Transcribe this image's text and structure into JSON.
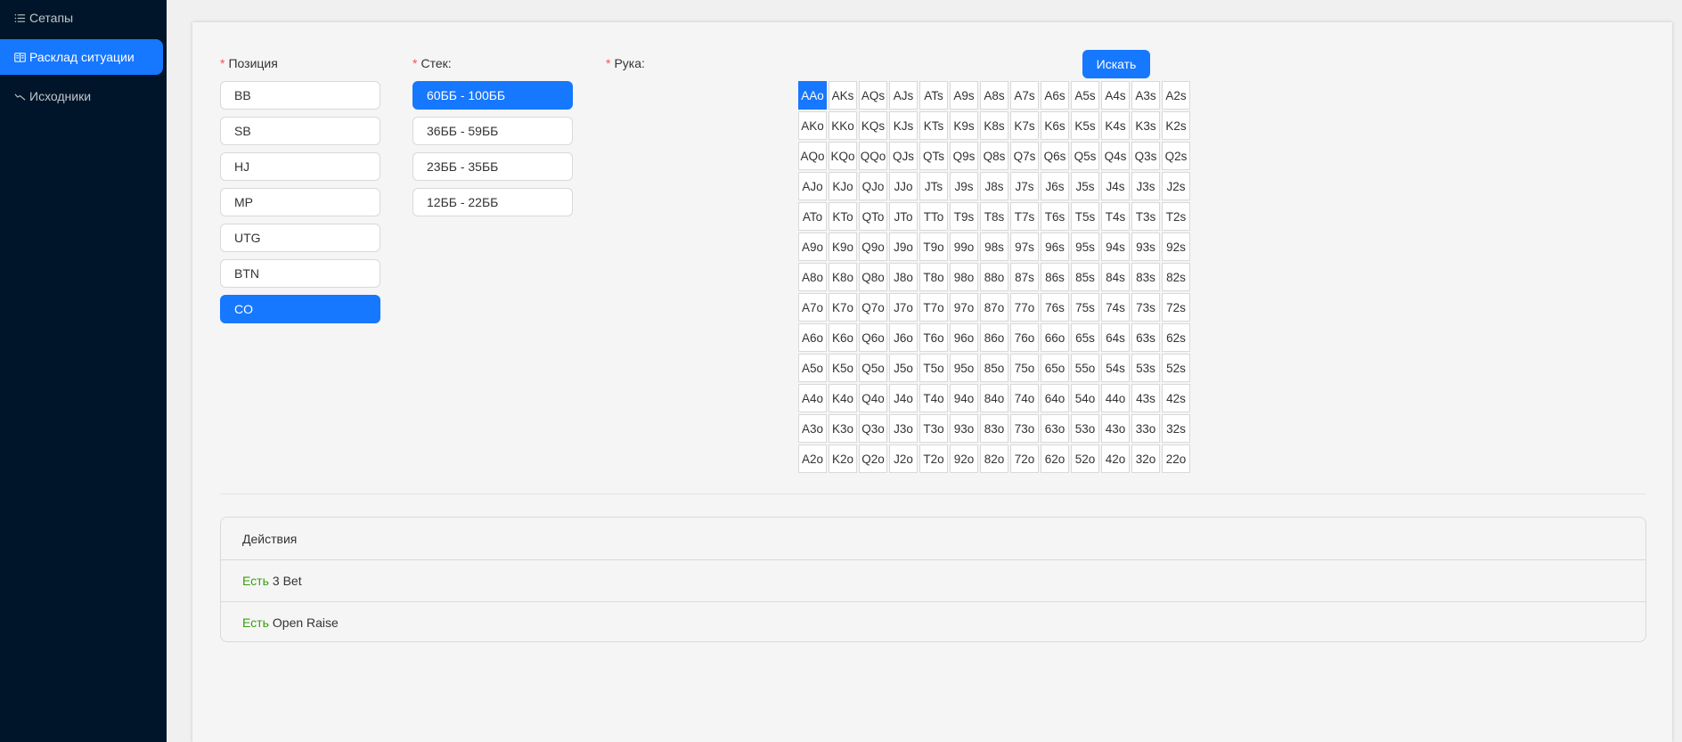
{
  "sidebar": {
    "items": [
      {
        "label": "Сетапы",
        "icon": "list-icon",
        "active": false
      },
      {
        "label": "Расклад ситуации",
        "icon": "read-icon",
        "active": true
      },
      {
        "label": "Исходники",
        "icon": "stock-icon",
        "active": false
      }
    ]
  },
  "form": {
    "position_label": "Позиция",
    "stack_label": "Стек:",
    "hand_label": "Рука:",
    "required_mark": "*",
    "positions": [
      "BB",
      "SB",
      "HJ",
      "MP",
      "UTG",
      "BTN",
      "CO"
    ],
    "selected_position": "CO",
    "stacks": [
      "60ББ - 100ББ",
      "36ББ - 59ББ",
      "23ББ - 35ББ",
      "12ББ - 22ББ"
    ],
    "selected_stack": "60ББ - 100ББ",
    "search_label": "Искать",
    "selected_hand": "AAo",
    "hands": [
      [
        "AAo",
        "AKs",
        "AQs",
        "AJs",
        "ATs",
        "A9s",
        "A8s",
        "A7s",
        "A6s",
        "A5s",
        "A4s",
        "A3s",
        "A2s"
      ],
      [
        "AKo",
        "KKo",
        "KQs",
        "KJs",
        "KTs",
        "K9s",
        "K8s",
        "K7s",
        "K6s",
        "K5s",
        "K4s",
        "K3s",
        "K2s"
      ],
      [
        "AQo",
        "KQo",
        "QQo",
        "QJs",
        "QTs",
        "Q9s",
        "Q8s",
        "Q7s",
        "Q6s",
        "Q5s",
        "Q4s",
        "Q3s",
        "Q2s"
      ],
      [
        "AJo",
        "KJo",
        "QJo",
        "JJo",
        "JTs",
        "J9s",
        "J8s",
        "J7s",
        "J6s",
        "J5s",
        "J4s",
        "J3s",
        "J2s"
      ],
      [
        "ATo",
        "KTo",
        "QTo",
        "JTo",
        "TTo",
        "T9s",
        "T8s",
        "T7s",
        "T6s",
        "T5s",
        "T4s",
        "T3s",
        "T2s"
      ],
      [
        "A9o",
        "K9o",
        "Q9o",
        "J9o",
        "T9o",
        "99o",
        "98s",
        "97s",
        "96s",
        "95s",
        "94s",
        "93s",
        "92s"
      ],
      [
        "A8o",
        "K8o",
        "Q8o",
        "J8o",
        "T8o",
        "98o",
        "88o",
        "87s",
        "86s",
        "85s",
        "84s",
        "83s",
        "82s"
      ],
      [
        "A7o",
        "K7o",
        "Q7o",
        "J7o",
        "T7o",
        "97o",
        "87o",
        "77o",
        "76s",
        "75s",
        "74s",
        "73s",
        "72s"
      ],
      [
        "A6o",
        "K6o",
        "Q6o",
        "J6o",
        "T6o",
        "96o",
        "86o",
        "76o",
        "66o",
        "65s",
        "64s",
        "63s",
        "62s"
      ],
      [
        "A5o",
        "K5o",
        "Q5o",
        "J5o",
        "T5o",
        "95o",
        "85o",
        "75o",
        "65o",
        "55o",
        "54s",
        "53s",
        "52s"
      ],
      [
        "A4o",
        "K4o",
        "Q4o",
        "J4o",
        "T4o",
        "94o",
        "84o",
        "74o",
        "64o",
        "54o",
        "44o",
        "43s",
        "42s"
      ],
      [
        "A3o",
        "K3o",
        "Q3o",
        "J3o",
        "T3o",
        "93o",
        "83o",
        "73o",
        "63o",
        "53o",
        "43o",
        "33o",
        "32s"
      ],
      [
        "A2o",
        "K2o",
        "Q2o",
        "J2o",
        "T2o",
        "92o",
        "82o",
        "72o",
        "62o",
        "52o",
        "42o",
        "32o",
        "22o"
      ]
    ]
  },
  "actions": {
    "header": "Действия",
    "rows": [
      {
        "status": "Есть",
        "text": "3 Bet"
      },
      {
        "status": "Есть",
        "text": "Open Raise"
      }
    ]
  },
  "colors": {
    "primary": "#1677ff",
    "sidebar_bg": "#001529",
    "required": "#ff4d4f",
    "status_green": "#389e0d"
  }
}
